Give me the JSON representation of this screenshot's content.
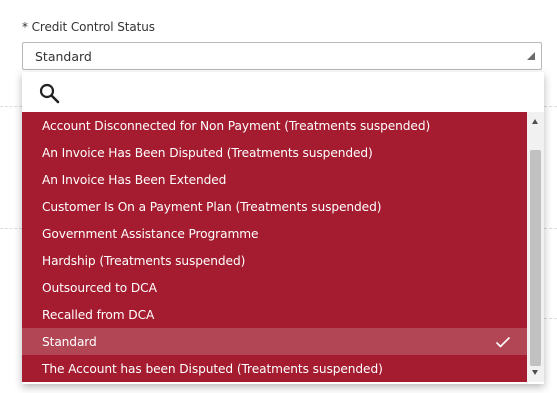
{
  "field": {
    "label": "* Credit Control Status",
    "selected_value": "Standard"
  },
  "dropdown": {
    "search_icon": "search-icon",
    "options": [
      {
        "label": "Account Disconnected for Non Payment (Treatments suspended)",
        "selected": false
      },
      {
        "label": "An Invoice Has Been Disputed (Treatments suspended)",
        "selected": false
      },
      {
        "label": "An Invoice Has Been Extended",
        "selected": false
      },
      {
        "label": "Customer Is On a Payment Plan (Treatments suspended)",
        "selected": false
      },
      {
        "label": "Government Assistance Programme",
        "selected": false
      },
      {
        "label": "Hardship (Treatments suspended)",
        "selected": false
      },
      {
        "label": "Outsourced to DCA",
        "selected": false
      },
      {
        "label": "Recalled from DCA",
        "selected": false
      },
      {
        "label": "Standard",
        "selected": true
      },
      {
        "label": "The Account has been Disputed (Treatments suspended)",
        "selected": false
      }
    ],
    "selected_icon": "check-icon"
  },
  "colors": {
    "option_bg": "#a51b2f",
    "option_selected_bg": "#b24655",
    "option_text": "#ffffff"
  }
}
